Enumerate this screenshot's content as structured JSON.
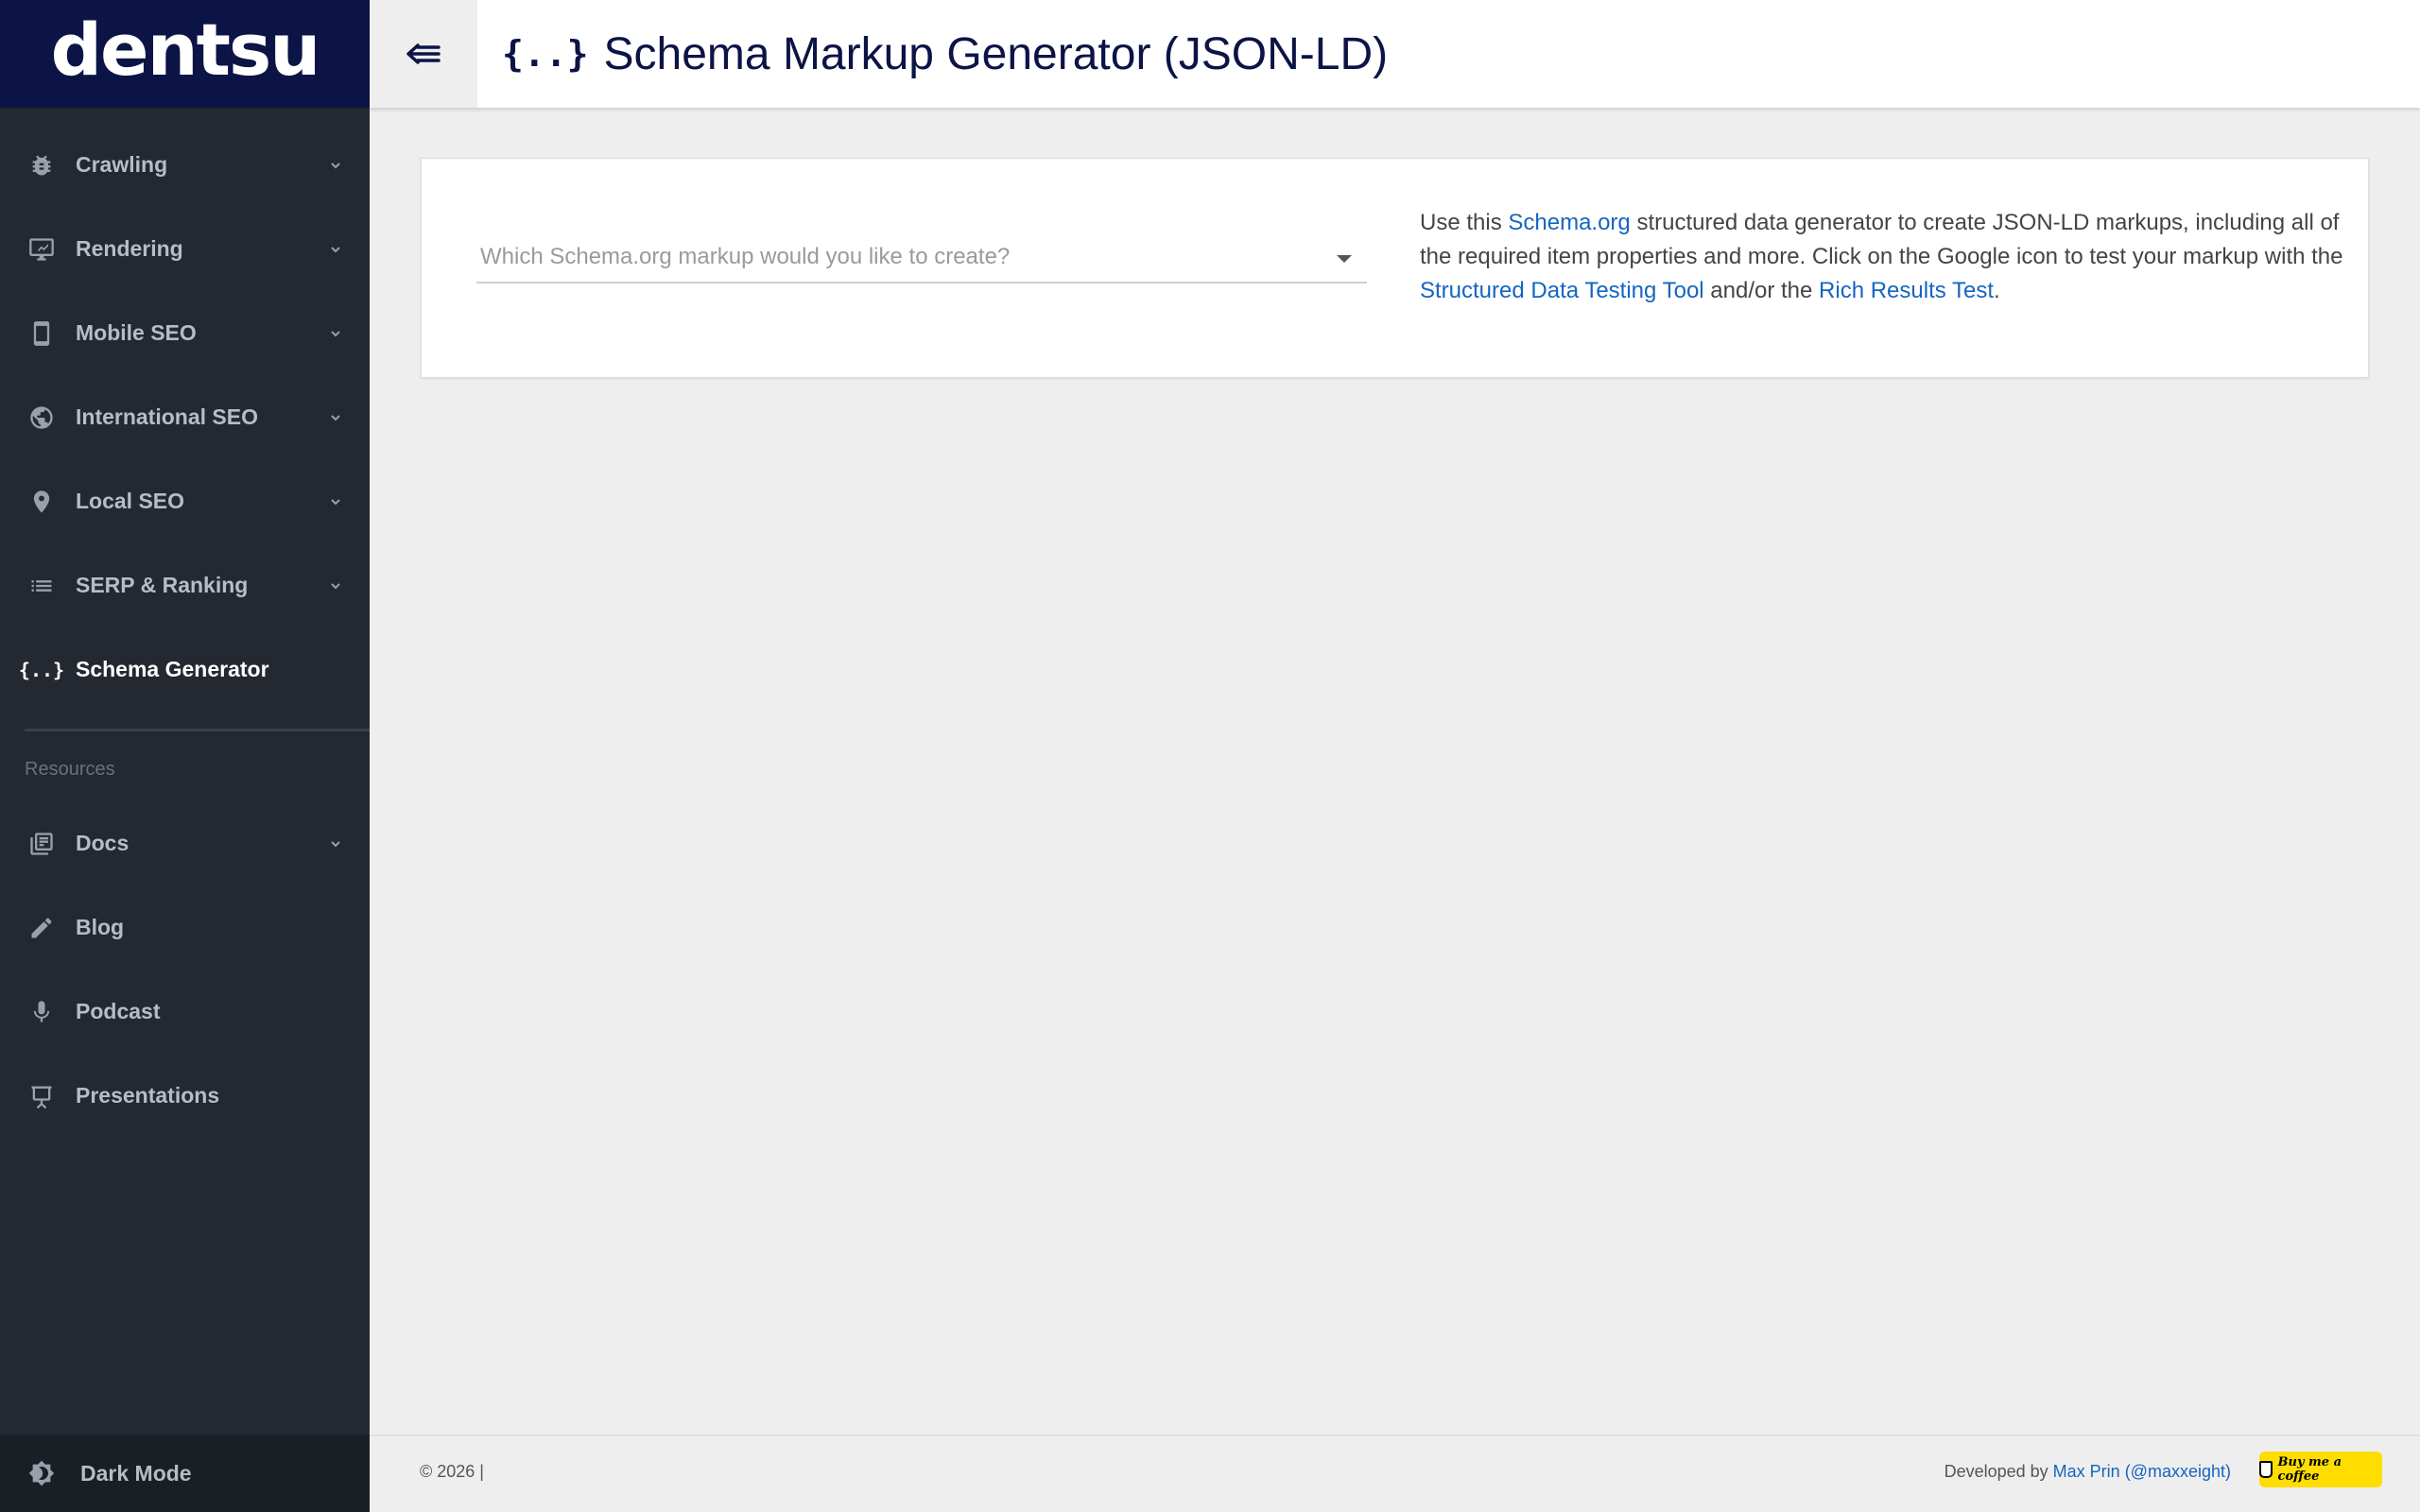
{
  "brand": {
    "logo": "dentsu"
  },
  "header": {
    "brace": "{..}",
    "title": "Schema Markup Generator (JSON-LD)"
  },
  "sidebar": {
    "items": [
      {
        "label": "Crawling",
        "icon": "bug-icon",
        "expandable": true
      },
      {
        "label": "Rendering",
        "icon": "monitor-icon",
        "expandable": true
      },
      {
        "label": "Mobile SEO",
        "icon": "phone-icon",
        "expandable": true
      },
      {
        "label": "International SEO",
        "icon": "globe-icon",
        "expandable": true
      },
      {
        "label": "Local SEO",
        "icon": "map-pin-icon",
        "expandable": true
      },
      {
        "label": "SERP & Ranking",
        "icon": "list-icon",
        "expandable": true
      },
      {
        "label": "Schema Generator",
        "icon": "brace-icon",
        "expandable": false,
        "active": true
      }
    ],
    "section_label": "Resources",
    "resources": [
      {
        "label": "Docs",
        "icon": "docs-icon",
        "expandable": true
      },
      {
        "label": "Blog",
        "icon": "pencil-icon",
        "expandable": false
      },
      {
        "label": "Podcast",
        "icon": "mic-icon",
        "expandable": false
      },
      {
        "label": "Presentations",
        "icon": "presentation-icon",
        "expandable": false
      }
    ],
    "dark_mode": "Dark Mode"
  },
  "main": {
    "select_placeholder": "Which Schema.org markup would you like to create?",
    "desc": {
      "t1": "Use this ",
      "link1": "Schema.org",
      "t2": " structured data generator to create JSON-LD markups, including all of the required item properties and more. Click on the Google icon to test your markup with the ",
      "link2": "Structured Data Testing Tool",
      "t3": " and/or the ",
      "link3": "Rich Results Test",
      "t4": "."
    }
  },
  "footer": {
    "copyright": "© 2026 |",
    "dev_prefix": "Developed by ",
    "dev_link": "Max Prin (@maxxeight)",
    "bmc_label": "Buy me a coffee"
  },
  "colors": {
    "navy": "#0c1446",
    "sidebar": "#232831",
    "link": "#1565c0",
    "bmc": "#ffdd00"
  }
}
